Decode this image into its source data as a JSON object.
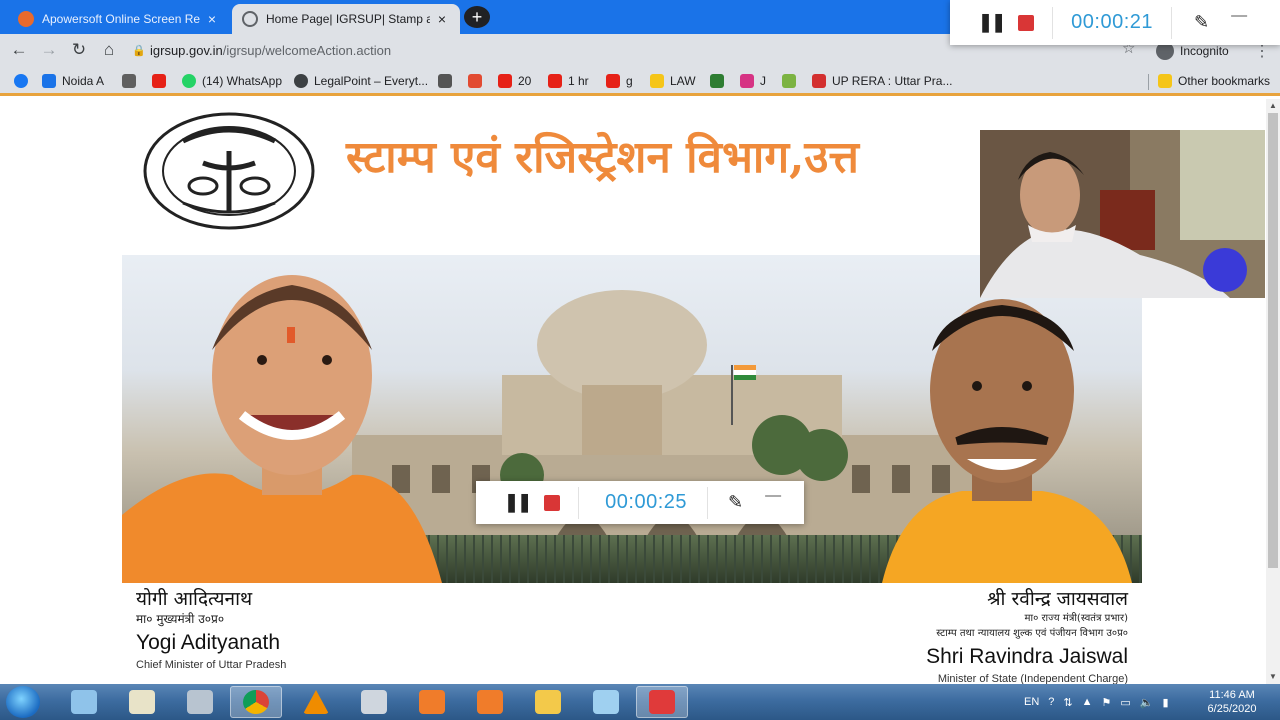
{
  "browser": {
    "tabs": [
      {
        "title": "Apowersoft Online Screen Recor",
        "active": false
      },
      {
        "title": "Home Page| IGRSUP| Stamp and",
        "active": true
      }
    ],
    "new_tab": "+",
    "close_glyph": "×",
    "url_host": "igrsup.gov.in",
    "url_path": "/igrsup/welcomeAction.action",
    "incognito_label": "Incognito",
    "bookmarks": [
      {
        "label": "Noida A",
        "color": "#1a73e8"
      },
      {
        "label": "",
        "color": "#606060"
      },
      {
        "label": "",
        "color": "#e62117"
      },
      {
        "label": "(14) WhatsApp",
        "color": "#25d366"
      },
      {
        "label": "LegalPoint – Everyt...",
        "color": "#3c4043"
      },
      {
        "label": "",
        "color": "#555555"
      },
      {
        "label": "",
        "color": "#e24b32"
      },
      {
        "label": "20",
        "color": "#e62117"
      },
      {
        "label": "1 hr",
        "color": "#e62117"
      },
      {
        "label": "g",
        "color": "#e62117"
      },
      {
        "label": "LAW",
        "color": "#f5c518"
      },
      {
        "label": "",
        "color": "#2e7d32"
      },
      {
        "label": "J",
        "color": "#d63384"
      },
      {
        "label": "",
        "color": "#7cb342"
      },
      {
        "label": "UP RERA : Uttar Pra...",
        "color": "#d32f2f"
      }
    ],
    "other_bookmarks": "Other bookmarks"
  },
  "page": {
    "headline": "स्टाम्प एवं रजिस्ट्रेशन विभाग,उत्त",
    "left_person": {
      "name_hi": "योगी आदित्यनाथ",
      "title_hi": "मा० मुख्यमंत्री उ०प्र०",
      "name_en": "Yogi Adityanath",
      "title_en": "Chief Minister of Uttar Pradesh"
    },
    "right_person": {
      "name_hi": "श्री रवीन्द्र जायसवाल",
      "title_hi_1": "मा० राज्य मंत्री(स्वतंत्र प्रभार)",
      "title_hi_2": "स्टाम्प तथा न्यायालय शुल्क एवं पंजीयन विभाग उ०प्र०",
      "name_en": "Shri Ravindra Jaiswal",
      "title_en": "Minister of State (Independent Charge)"
    }
  },
  "recorder_top": {
    "time": "00:00:21",
    "pause": "❚❚",
    "pen": "✎",
    "minimize": "—"
  },
  "recorder_center": {
    "time": "00:00:25",
    "pause": "❚❚",
    "pen": "✎",
    "minimize": "—"
  },
  "taskbar": {
    "apps": [
      "explorer-window",
      "notepad-pen",
      "calculator",
      "chrome",
      "vlc",
      "printer",
      "screen-recorder",
      "camera",
      "folder",
      "paint",
      "apowersoft"
    ],
    "language": "EN",
    "time": "11:46 AM",
    "date": "6/25/2020"
  },
  "colors": {
    "accent_blue": "#1a73e8",
    "headline_orange": "#ef8a3b",
    "recorder_time": "#2f9ad6",
    "stop_red": "#d93636"
  }
}
